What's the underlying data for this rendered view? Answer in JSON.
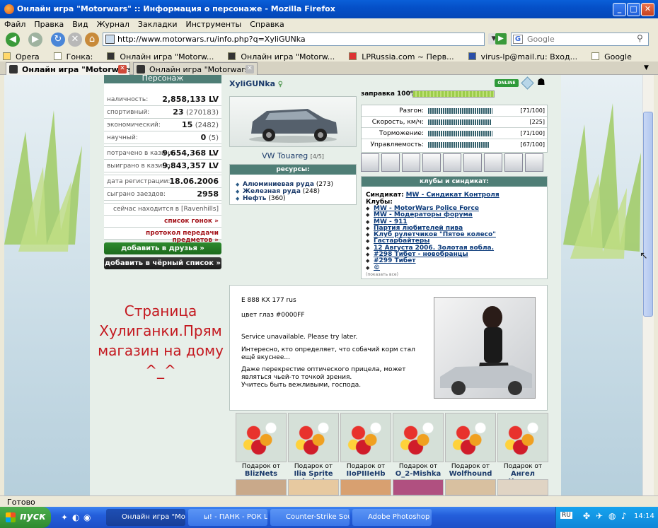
{
  "window": {
    "title": "Онлайн игра \"Motorwars\" :: Информация о персонаже - Mozilla Firefox"
  },
  "menu": [
    "Файл",
    "Правка",
    "Вид",
    "Журнал",
    "Закладки",
    "Инструменты",
    "Справка"
  ],
  "nav": {
    "url": "http://www.motorwars.ru/info.php?q=XyliGUNka",
    "search_placeholder": "Google"
  },
  "bookmarks": [
    "Opera",
    "Гонка:",
    "Онлайн игра \"Motorw...",
    "Онлайн игра \"Motorw...",
    "LPRussia.com ~ Перв...",
    "virus-lp@mail.ru: Вход...",
    "Google"
  ],
  "tabs": [
    {
      "label": "Онлайн игра \"Motorwars\" :: Ин..."
    },
    {
      "label": "Онлайн игра \"Motorwars\""
    }
  ],
  "left": {
    "header": "Персонаж",
    "stats": [
      {
        "label": "наличность:",
        "value": "2,858,133 LV",
        "sub": ""
      },
      {
        "label": "спортивный:",
        "value": "23",
        "sub": "(270183)"
      },
      {
        "label": "экономический:",
        "value": "15",
        "sub": "(2482)"
      },
      {
        "label": "научный:",
        "value": "0",
        "sub": "(5)"
      }
    ],
    "casino": [
      {
        "label": "потрачено в казино:",
        "value": "9,654,368 LV"
      },
      {
        "label": "выиграно в казино:",
        "value": "9,843,357 LV"
      }
    ],
    "reg": [
      {
        "label": "дата регистрации:",
        "value": "18.06.2006"
      },
      {
        "label": "сыграно заездов:",
        "value": "2958"
      }
    ],
    "location": "сейчас находится в [Ravenhills]",
    "race_list": "список гонок »",
    "transfer_log": "протокол передачи предметов »",
    "add_friend": "добавить в друзья »",
    "add_black": "добавить в чёрный список »",
    "caption": "Страница Хулиганки.Прям магазин на дому ^_^"
  },
  "middle": {
    "player": "XyliGUNka",
    "car_name": "VW Touareg",
    "car_sub": "[4/5]",
    "resources_header": "ресурсы:",
    "resources": [
      {
        "name": "Алюминиевая руда",
        "count": "(273)"
      },
      {
        "name": "Железная руда",
        "count": "(248)"
      },
      {
        "name": "Нефть",
        "count": "(360)"
      }
    ]
  },
  "right": {
    "online": "ONLINE",
    "fuel_label": "заправка 100%",
    "fuel_percent": 100,
    "stats": [
      {
        "label": "Разгон:",
        "value": "[71/100]",
        "fraction": 0.71
      },
      {
        "label": "Скорость, км/ч:",
        "value": "[225]",
        "fraction": 0.7
      },
      {
        "label": "Торможение:",
        "value": "[71/100]",
        "fraction": 0.71
      },
      {
        "label": "Управляемость:",
        "value": "[67/100]",
        "fraction": 0.67
      }
    ],
    "clubs_header": "клубы и синдикат:",
    "syndicate_label": "Синдикат:",
    "syndicate": "MW - Синдикат Контроля",
    "clubs_label": "Клубы:",
    "clubs": [
      "MW - MotorWars Police Force",
      "MW - Модераторы форума",
      "MW - 911",
      "Партия любителей пива",
      "Клуб рулетчиков \"Пятое колесо\"",
      "Гастарбайтеры",
      "12 Августа 2006. Золотая вобла.",
      "#298 Тибет - новобранцы",
      "#299 Тибет",
      "©"
    ],
    "show_all": "(показать все)"
  },
  "info": {
    "plate": "E 888 KX 177 rus",
    "eyes": "цвет глаз #0000FF",
    "service": "Service unavailable. Please try later.",
    "q1": "Интересно, кто определяет, что собачий корм стал ещё вкуснее...",
    "q2": "Даже перекрестие оптического прицела, может являться чьей-то точкой зрения.",
    "q3": "Учитесь быть вежливыми, господа."
  },
  "gifts": [
    {
      "from": "Подарок от",
      "name": "BlizNets"
    },
    {
      "from": "Подарок от",
      "name": "Ilia Sprite (adm)"
    },
    {
      "from": "Подарок от",
      "name": "IIoPIIIeHb"
    },
    {
      "from": "Подарок от",
      "name": "O_2-Mishka"
    },
    {
      "from": "Подарок от",
      "name": "Wolfhound"
    },
    {
      "from": "Подарок от",
      "name": "Ангел Чертов"
    }
  ],
  "status": "Готово",
  "taskbar": {
    "start": "пуск",
    "tasks": [
      "Онлайн игра \"Motor...",
      "ы! - ПАНК - РОК ШО...",
      "Counter-Strike Source",
      "Adobe Photoshop"
    ],
    "lang": "RU",
    "clock": "14:14"
  },
  "colors": {
    "accent": "#4f7e76",
    "link": "#1b3a6a",
    "red": "#a3131a"
  }
}
